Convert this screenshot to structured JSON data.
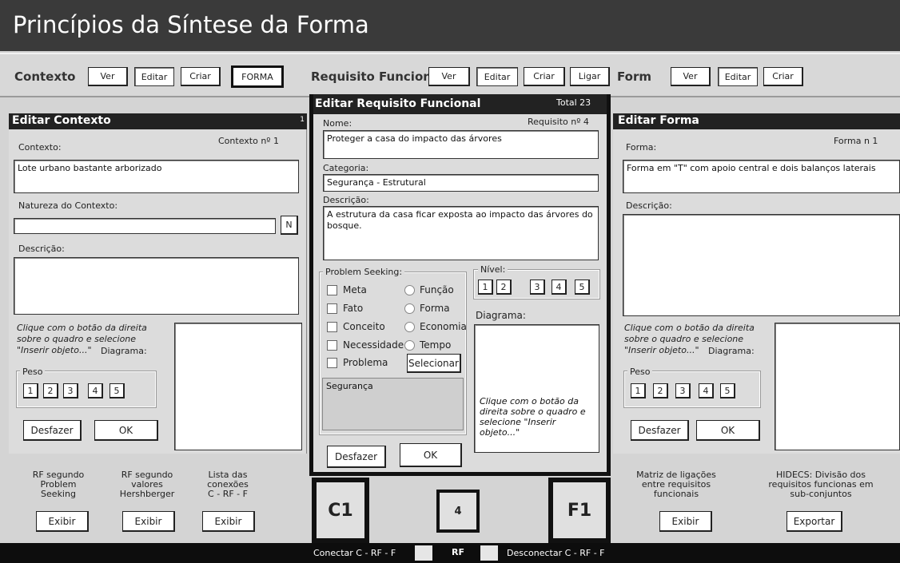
{
  "app_title": "Princípios da Síntese da Forma",
  "toolbar": {
    "contexto_label": "Contexto",
    "contexto_ver": "Ver",
    "contexto_editar": "Editar",
    "contexto_criar": "Criar",
    "contexto_forma": "FORMA",
    "requisito_label": "Requisito Funcion",
    "requisito_ver": "Ver",
    "requisito_editar": "Editar",
    "requisito_criar": "Criar",
    "requisito_ligar": "Ligar",
    "form_label": "Form",
    "form_ver": "Ver",
    "form_editar": "Editar",
    "form_criar": "Criar"
  },
  "contexto_panel": {
    "title": "Editar Contexto",
    "corner_number": "1",
    "contexto_label": "Contexto:",
    "contexto_numero": "Contexto nº  1",
    "contexto_value": "Lote urbano bastante arborizado",
    "natureza_label": "Natureza do Contexto:",
    "natureza_value": "",
    "n_button": "N",
    "descricao_label": "Descrição:",
    "descricao_value": "",
    "hint_line1": "Clique com o botão da direita",
    "hint_line2": "sobre o quadro e selecione",
    "hint_line3": "\"Inserir objeto...\"",
    "diagrama_label": "Diagrama:",
    "peso_label": "Peso",
    "peso_values": [
      "1",
      "2",
      "3",
      "4",
      "5"
    ],
    "desfazer": "Desfazer",
    "ok": "OK"
  },
  "requisito_panel": {
    "title": "Editar Requisito Funcional",
    "total": "Total  23",
    "nome_label": "Nome:",
    "requisito_numero": "Requisito nº  4",
    "nome_value": "Proteger a casa do impacto das árvores",
    "categoria_label": "Categoria:",
    "categoria_value": "Segurança - Estrutural",
    "descricao_label": "Descrição:",
    "descricao_value": "A estrutura da casa ficar exposta ao impacto das árvores do bosque.",
    "problem_seeking_label": "Problem Seeking:",
    "checkboxes": [
      "Meta",
      "Fato",
      "Conceito",
      "Necessidade",
      "Problema"
    ],
    "radios": [
      "Função",
      "Forma",
      "Economia",
      "Tempo"
    ],
    "selecionar": "Selecionar",
    "selection_value": "Segurança",
    "nivel_label": "Nível:",
    "nivel_values": [
      "1",
      "2",
      "3",
      "4",
      "5"
    ],
    "diagrama_label": "Diagrama:",
    "diagrama_hint": "Clique com o botão da direita sobre o quadro e selecione \"Inserir objeto...\"",
    "desfazer": "Desfazer",
    "ok": "OK"
  },
  "forma_panel": {
    "title": "Editar Forma",
    "forma_label": "Forma:",
    "forma_numero": "Forma n  1",
    "forma_value": "Forma em \"T\" com apoio central e dois balanços laterais",
    "descricao_label": "Descrição:",
    "descricao_value": "",
    "hint_line1": "Clique com o botão da direita",
    "hint_line2": "sobre o quadro e selecione",
    "hint_line3": "\"Inserir objeto...\"",
    "diagrama_label": "Diagrama:",
    "peso_label": "Peso",
    "peso_values": [
      "1",
      "2",
      "3",
      "4",
      "5"
    ],
    "desfazer": "Desfazer",
    "ok": "OK"
  },
  "bottom_left": {
    "rf_problem": [
      "RF segundo",
      "Problem",
      "Seeking"
    ],
    "rf_valores": [
      "RF segundo",
      "valores",
      "Hershberger"
    ],
    "lista": [
      "Lista das",
      "conexões",
      "C - RF - F"
    ],
    "exibir": "Exibir"
  },
  "bottom_center": {
    "c_box": "C1",
    "rf_box": "4",
    "f_box": "F1"
  },
  "bottom_right": {
    "matriz": [
      "Matriz de ligações",
      "entre requisitos",
      "funcionais"
    ],
    "exibir": "Exibir",
    "hidecs": [
      "HIDECS: Divisão dos",
      "requisitos funcionas  em",
      "sub-conjuntos"
    ],
    "exportar": "Exportar"
  },
  "statusbar": {
    "conectar": "Conectar C - RF - F",
    "rf": "RF",
    "desconectar": "Desconectar C - RF - F"
  }
}
